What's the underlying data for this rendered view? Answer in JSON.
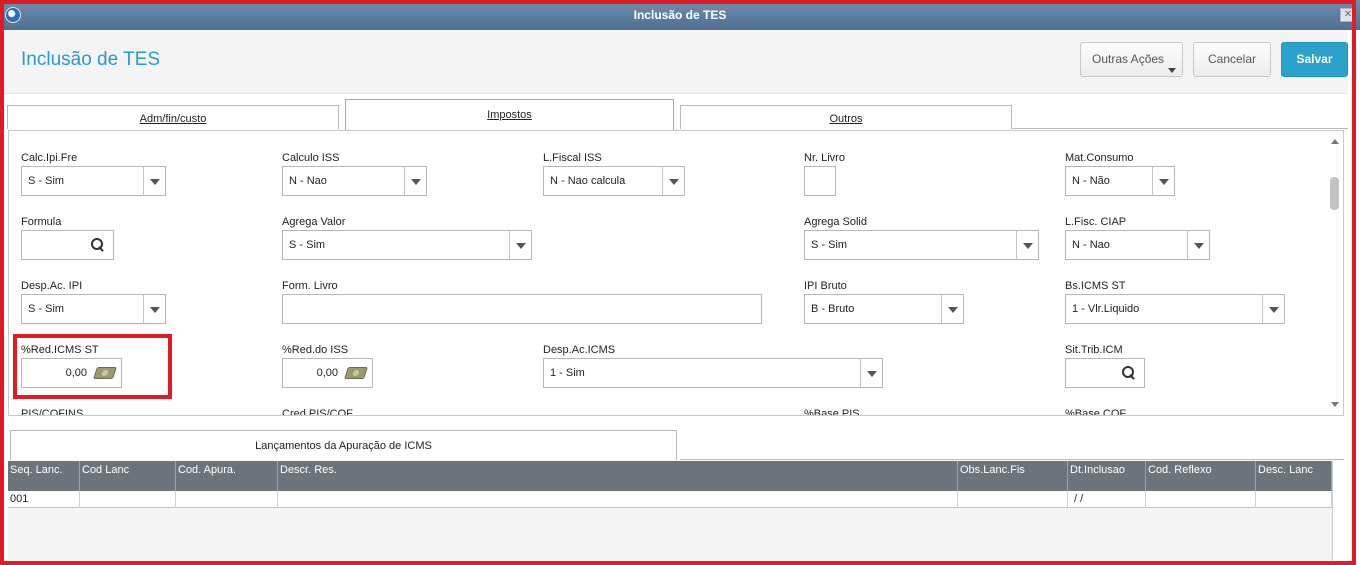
{
  "window": {
    "title": "Inclusão de TES"
  },
  "header": {
    "page_title": "Inclusão de TES",
    "more_actions_label": "Outras Ações",
    "cancel_label": "Cancelar",
    "save_label": "Salvar"
  },
  "tabs": [
    {
      "label": "Adm/fin/custo",
      "active": false
    },
    {
      "label": "Impostos",
      "active": true
    },
    {
      "label": "Outros",
      "active": false
    }
  ],
  "form": {
    "calc_ipi_fre": {
      "label": "Calc.Ipi.Fre",
      "value": "S - Sim"
    },
    "calculo_iss": {
      "label": "Calculo ISS",
      "value": "N - Nao"
    },
    "l_fiscal_iss": {
      "label": "L.Fiscal ISS",
      "value": "N - Nao calcula"
    },
    "nr_livro": {
      "label": "Nr. Livro",
      "value": ""
    },
    "mat_consumo": {
      "label": "Mat.Consumo",
      "value": "N - Não"
    },
    "formula": {
      "label": "Formula",
      "value": ""
    },
    "agrega_valor": {
      "label": "Agrega Valor",
      "value": "S - Sim"
    },
    "agrega_solid": {
      "label": "Agrega Solid",
      "value": "S - Sim"
    },
    "l_fisc_ciap": {
      "label": "L.Fisc. CIAP",
      "value": "N - Nao"
    },
    "desp_ac_ipi": {
      "label": "Desp.Ac. IPI",
      "value": "S - Sim"
    },
    "form_livro": {
      "label": "Form. Livro",
      "value": ""
    },
    "ipi_bruto": {
      "label": "IPI Bruto",
      "value": "B - Bruto"
    },
    "bs_icms_st": {
      "label": "Bs.ICMS ST",
      "value": "1 - Vlr.Liquido"
    },
    "red_icms_st": {
      "label": "%Red.ICMS ST",
      "value": "0,00"
    },
    "red_do_iss": {
      "label": "%Red.do ISS",
      "value": "0,00"
    },
    "desp_ac_icms": {
      "label": "Desp.Ac.ICMS",
      "value": "1 - Sim"
    },
    "sit_trib_icm": {
      "label": "Sit.Trib.ICM",
      "value": ""
    },
    "pis_cofins": {
      "label": "PIS/COFINS"
    },
    "cred_pis_cof": {
      "label": "Cred.PIS/COF"
    },
    "base_pis": {
      "label": "%Base PIS"
    },
    "base_cof": {
      "label": "%Base COF"
    }
  },
  "sub_tab": {
    "label": "Lançamentos da Apuração de ICMS"
  },
  "grid": {
    "columns": [
      "Seq. Lanc.",
      "Cod Lanc",
      "Cod. Apura.",
      "Descr. Res.",
      "Obs.Lanc.Fis",
      "Dt.Inclusao",
      "Cod. Reflexo",
      "Desc. Lanc"
    ],
    "rows": [
      [
        "001",
        "",
        "",
        "",
        "",
        " / /",
        "",
        ""
      ]
    ]
  }
}
